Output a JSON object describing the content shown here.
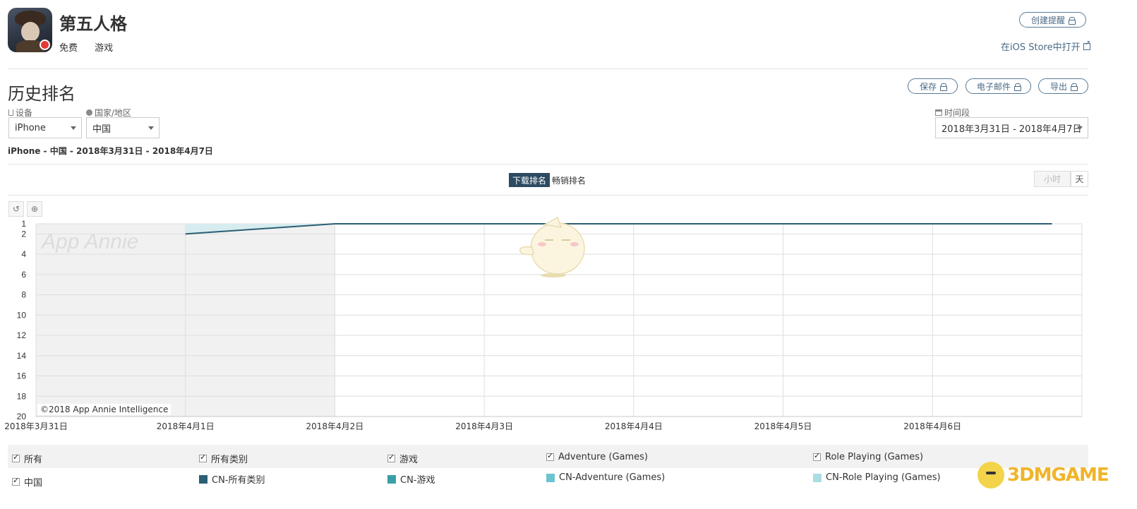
{
  "app": {
    "name": "第五人格",
    "price": "免费",
    "category": "游戏",
    "create_alert_label": "创建提醒",
    "store_link_label": "在iOS Store中打开"
  },
  "section": {
    "title": "历史排名",
    "save_label": "保存",
    "email_label": "电子邮件",
    "export_label": "导出"
  },
  "filters": {
    "device_label": "设备",
    "device_value": "iPhone",
    "country_label": "国家/地区",
    "country_value": "中国",
    "period_label": "时间段",
    "period_value": "2018年3月31日 - 2018年4月7日",
    "summary": "iPhone - 中国 - 2018年3月31日 - 2018年4月7日"
  },
  "tabs": {
    "downloads": "下载排名",
    "grossing": "畅销排名"
  },
  "granularity": {
    "hour": "小时",
    "day": "天"
  },
  "chart_data": {
    "type": "line",
    "x": [
      "2018年3月31日",
      "2018年4月1日",
      "2018年4月2日",
      "2018年4月3日",
      "2018年4月4日",
      "2018年4月5日",
      "2018年4月6日"
    ],
    "y_ticks": [
      1,
      2,
      4,
      6,
      8,
      10,
      12,
      14,
      16,
      18,
      20
    ],
    "ylim": [
      1,
      20
    ],
    "y_inverted": true,
    "grid": true,
    "watermark": "App Annie",
    "shaded_days": [
      "2018年3月31日",
      "2018年4月1日"
    ],
    "series": [
      {
        "name": "CN-所有类别",
        "color": "#2b5f73",
        "points": [
          [
            1,
            2
          ],
          [
            2,
            1
          ],
          [
            6.8,
            1
          ]
        ]
      },
      {
        "name": "CN-游戏",
        "color": "#3a9fa8",
        "points": [
          [
            2,
            1
          ],
          [
            6.8,
            1
          ]
        ]
      },
      {
        "name": "CN-Adventure (Games)",
        "color": "#6cc4d0",
        "points": [
          [
            2,
            1
          ],
          [
            6.8,
            1
          ]
        ]
      },
      {
        "name": "CN-Role Playing (Games)",
        "color": "#a8dde3",
        "points": [
          [
            2,
            1
          ],
          [
            6.8,
            1
          ]
        ]
      }
    ],
    "copyright": "©2018 App Annie Intelligence"
  },
  "legend": {
    "row1": [
      "所有",
      "所有类别",
      "游戏",
      "Adventure (Games)",
      "Role Playing (Games)"
    ],
    "country": "中国",
    "series_labels": [
      "CN-所有类别",
      "CN-游戏",
      "CN-Adventure (Games)",
      "CN-Role Playing (Games)"
    ],
    "colors": [
      "#2b5f73",
      "#3a9fa8",
      "#6cc4d0",
      "#a8dde3"
    ]
  },
  "watermark_site": "3DMGAME"
}
